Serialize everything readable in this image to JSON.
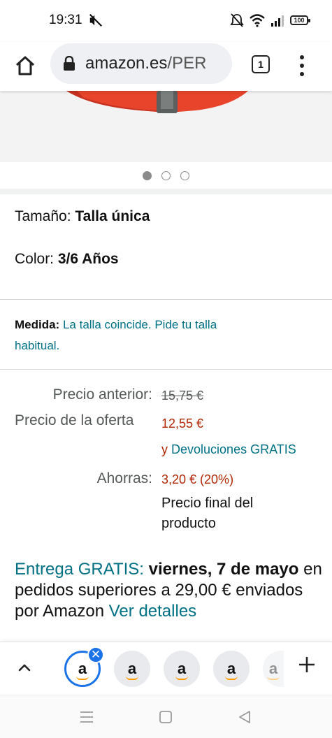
{
  "status_bar": {
    "time": "19:31",
    "battery": "100"
  },
  "browser": {
    "url_host": "amazon.es",
    "url_path": "/PER",
    "tab_count": "1"
  },
  "product": {
    "carousel": {
      "count": 3,
      "active_index": 0
    },
    "size_label": "Tamaño: ",
    "size_value": "Talla única",
    "color_label": "Color: ",
    "color_value": "3/6 Años",
    "fit_label": "Medida:",
    "fit_text": "La talla coincide. Pide tu talla habitual."
  },
  "pricing": {
    "previous_label": "Precio anterior:",
    "previous_value": "15,75 €",
    "offer_label": "Precio de la oferta",
    "offer_value": "12,55 €",
    "returns_prefix": "y",
    "returns_text": "Devoluciones GRATIS",
    "savings_label": "Ahorras:",
    "savings_value": "3,20 € (20%)",
    "final_note": "Precio final del producto"
  },
  "delivery": {
    "free_label": "Entrega GRATIS:",
    "date": "viernes, 7 de mayo",
    "text": "en pedidos superiores a 29,00 € enviados por Amazon",
    "details_link": "Ver detalles"
  },
  "tab_strip": {
    "tab_letter": "a",
    "tabs": 5
  },
  "colors": {
    "price_red": "#b12704",
    "link_teal": "#007185",
    "chrome_blue": "#1a73e8",
    "amazon_orange": "#ff9900"
  }
}
